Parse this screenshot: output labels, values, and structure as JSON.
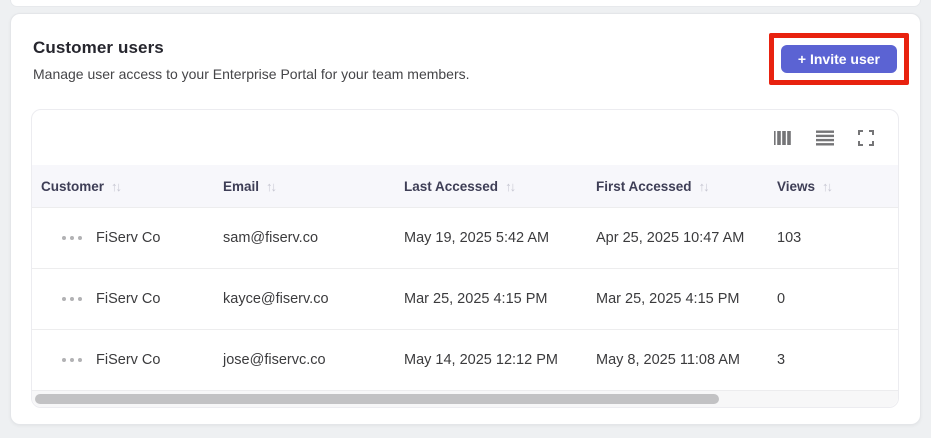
{
  "header": {
    "title": "Customer users",
    "subtitle": "Manage user access to your Enterprise Portal for your team members.",
    "invite_button_label": "+ Invite user"
  },
  "annotation": {
    "type": "highlight-box",
    "color": "#e8220f",
    "around": "invite-button"
  },
  "toolbar": {
    "icons": [
      {
        "name": "columns-icon"
      },
      {
        "name": "density-rows-icon"
      },
      {
        "name": "fullscreen-icon"
      }
    ]
  },
  "table": {
    "columns": [
      {
        "label": "Customer",
        "sortable": true
      },
      {
        "label": "Email",
        "sortable": true
      },
      {
        "label": "Last Accessed",
        "sortable": true
      },
      {
        "label": "First Accessed",
        "sortable": true
      },
      {
        "label": "Views",
        "sortable": true
      }
    ],
    "sort_glyph": "↑↓",
    "rows": [
      {
        "customer": "FiServ Co",
        "email": "sam@fiserv.co",
        "last_accessed": "May 19, 2025 5:42 AM",
        "first_accessed": "Apr 25, 2025 10:47 AM",
        "views": "103"
      },
      {
        "customer": "FiServ Co",
        "email": "kayce@fiserv.co",
        "last_accessed": "Mar 25, 2025 4:15 PM",
        "first_accessed": "Mar 25, 2025 4:15 PM",
        "views": "0"
      },
      {
        "customer": "FiServ Co",
        "email": "jose@fiservc.co",
        "last_accessed": "May 14, 2025 12:12 PM",
        "first_accessed": "May 8, 2025 11:08 AM",
        "views": "3"
      }
    ],
    "scrollbar": {
      "thumb_width_percent": "79%"
    }
  },
  "colors": {
    "accent_button": "#5b63d3",
    "annotation_red": "#e8220f",
    "header_row_bg": "#f7f7fb",
    "page_bg": "#eef0f2"
  }
}
